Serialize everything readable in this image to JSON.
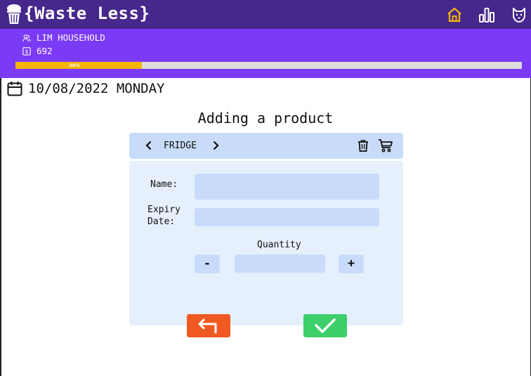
{
  "app": {
    "title": "{Waste Less}"
  },
  "nav": {
    "home_icon": "home-icon",
    "stats_icon": "bar-chart-icon",
    "profile_icon": "cat-face-icon",
    "active": "home"
  },
  "household": {
    "name": "LIM HOUSEHOLD",
    "points": "692",
    "progress_label": "26%",
    "progress_value": 0.25
  },
  "date": {
    "text": "10/08/2022 MONDAY"
  },
  "page": {
    "heading": "Adding a product"
  },
  "location": {
    "label": "FRIDGE"
  },
  "form": {
    "name_label": "Name:",
    "name_value": "",
    "expiry_label_line1": "Expiry",
    "expiry_label_line2": "Date:",
    "expiry_value": "",
    "quantity_label": "Quantity",
    "quantity_value": "",
    "minus": "-",
    "plus": "+"
  },
  "colors": {
    "topbar": "#46278c",
    "band": "#7b3af5",
    "progress": "#f5b40a",
    "panel": "#e6f0fd",
    "field": "#c8dcfa",
    "back_button": "#f05a22",
    "confirm_button": "#3ccf6a",
    "active_nav": "#f5b40a"
  }
}
